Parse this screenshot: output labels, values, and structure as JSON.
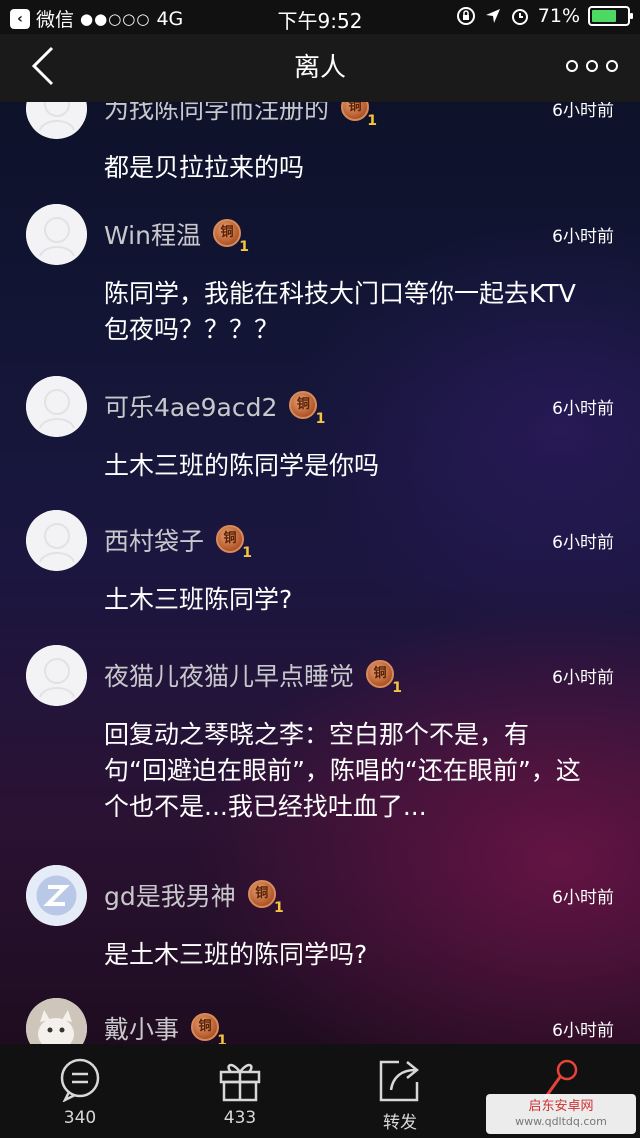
{
  "status_bar": {
    "carrier": "微信",
    "signal": "●●○○○",
    "network": "4G",
    "time": "下午9:52",
    "battery_percent": "71%",
    "battery_level": 0.71
  },
  "nav": {
    "title": "离人"
  },
  "comments": [
    {
      "user": "为找陈同学而注册的",
      "time": "6小时前",
      "text": "都是贝拉拉来的吗",
      "medal": "铜",
      "medal_level": "1"
    },
    {
      "user": "Win程温",
      "time": "6小时前",
      "text": "陈同学，我能在科技大门口等你一起去KTV包夜吗？？？？",
      "medal": "铜",
      "medal_level": "1"
    },
    {
      "user": "可乐4ae9acd2",
      "time": "6小时前",
      "text": "土木三班的陈同学是你吗",
      "medal": "铜",
      "medal_level": "1"
    },
    {
      "user": "西村袋子",
      "time": "6小时前",
      "text": "土木三班陈同学?",
      "medal": "铜",
      "medal_level": "1"
    },
    {
      "user": "夜猫儿夜猫儿早点睡觉",
      "time": "6小时前",
      "text": "回复动之琴晓之李：空白那个不是，有句“回避迫在眼前”，陈唱的“还在眼前”，这个也不是...我已经找吐血了...",
      "medal": "铜",
      "medal_level": "1"
    },
    {
      "user": "gd是我男神",
      "time": "6小时前",
      "text": "是土木三班的陈同学吗?",
      "medal": "铜",
      "medal_level": "1"
    },
    {
      "user": "戴小事",
      "time": "6小时前",
      "text": "",
      "medal": "铜",
      "medal_level": "1"
    }
  ],
  "toolbar": {
    "comments_count": "340",
    "gifts_count": "433",
    "share_label": "转发"
  },
  "watermark": {
    "name": "启东安卓网",
    "url": "www.qdltdq.com"
  },
  "icons": {
    "back": "chevron-left-icon",
    "more": "more-dots-icon",
    "comment": "comment-bubble-icon",
    "gift": "gift-icon",
    "share": "share-icon",
    "mic": "microphone-icon"
  }
}
